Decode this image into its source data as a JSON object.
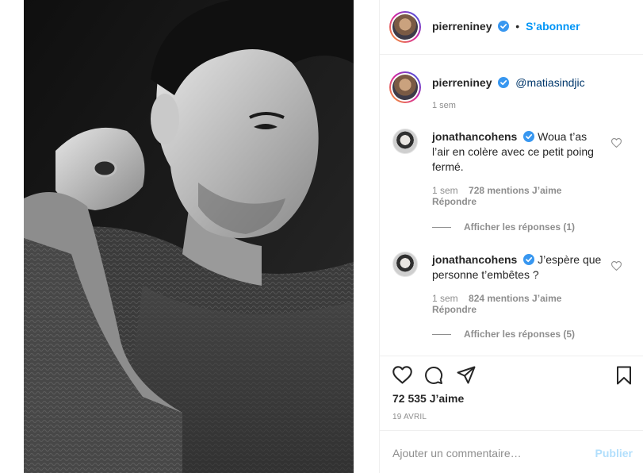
{
  "post": {
    "author": "pierreniney",
    "follow_label": "S’abonner",
    "separator": "•",
    "photo_description_icon": "portrait-photo"
  },
  "caption": {
    "username": "pierreniney",
    "mention": "@matiasindjic",
    "time": "1 sem"
  },
  "comments": [
    {
      "username": "jonathancohens",
      "text": "Woua t’as l’air en colère avec ce petit poing fermé.",
      "time": "1 sem",
      "likes": "728 mentions J’aime",
      "reply_label": "Répondre",
      "view_replies": "Afficher les réponses (1)"
    },
    {
      "username": "jonathancohens",
      "text": "J’espère que personne t’embêtes ?",
      "time": "1 sem",
      "likes": "824 mentions J’aime",
      "reply_label": "Répondre",
      "view_replies": "Afficher les réponses (5)"
    }
  ],
  "actions": {
    "icons": [
      "heart-icon",
      "comment-icon",
      "share-icon",
      "bookmark-icon"
    ],
    "likes_count": "72 535 J’aime",
    "date": "19 AVRIL"
  },
  "composer": {
    "placeholder": "Ajouter un commentaire…",
    "publish_label": "Publier"
  },
  "colors": {
    "accent": "#0095f6",
    "verified": "#3897f0",
    "muted": "#8e8e8e",
    "publish_disabled": "#b2dffc"
  }
}
